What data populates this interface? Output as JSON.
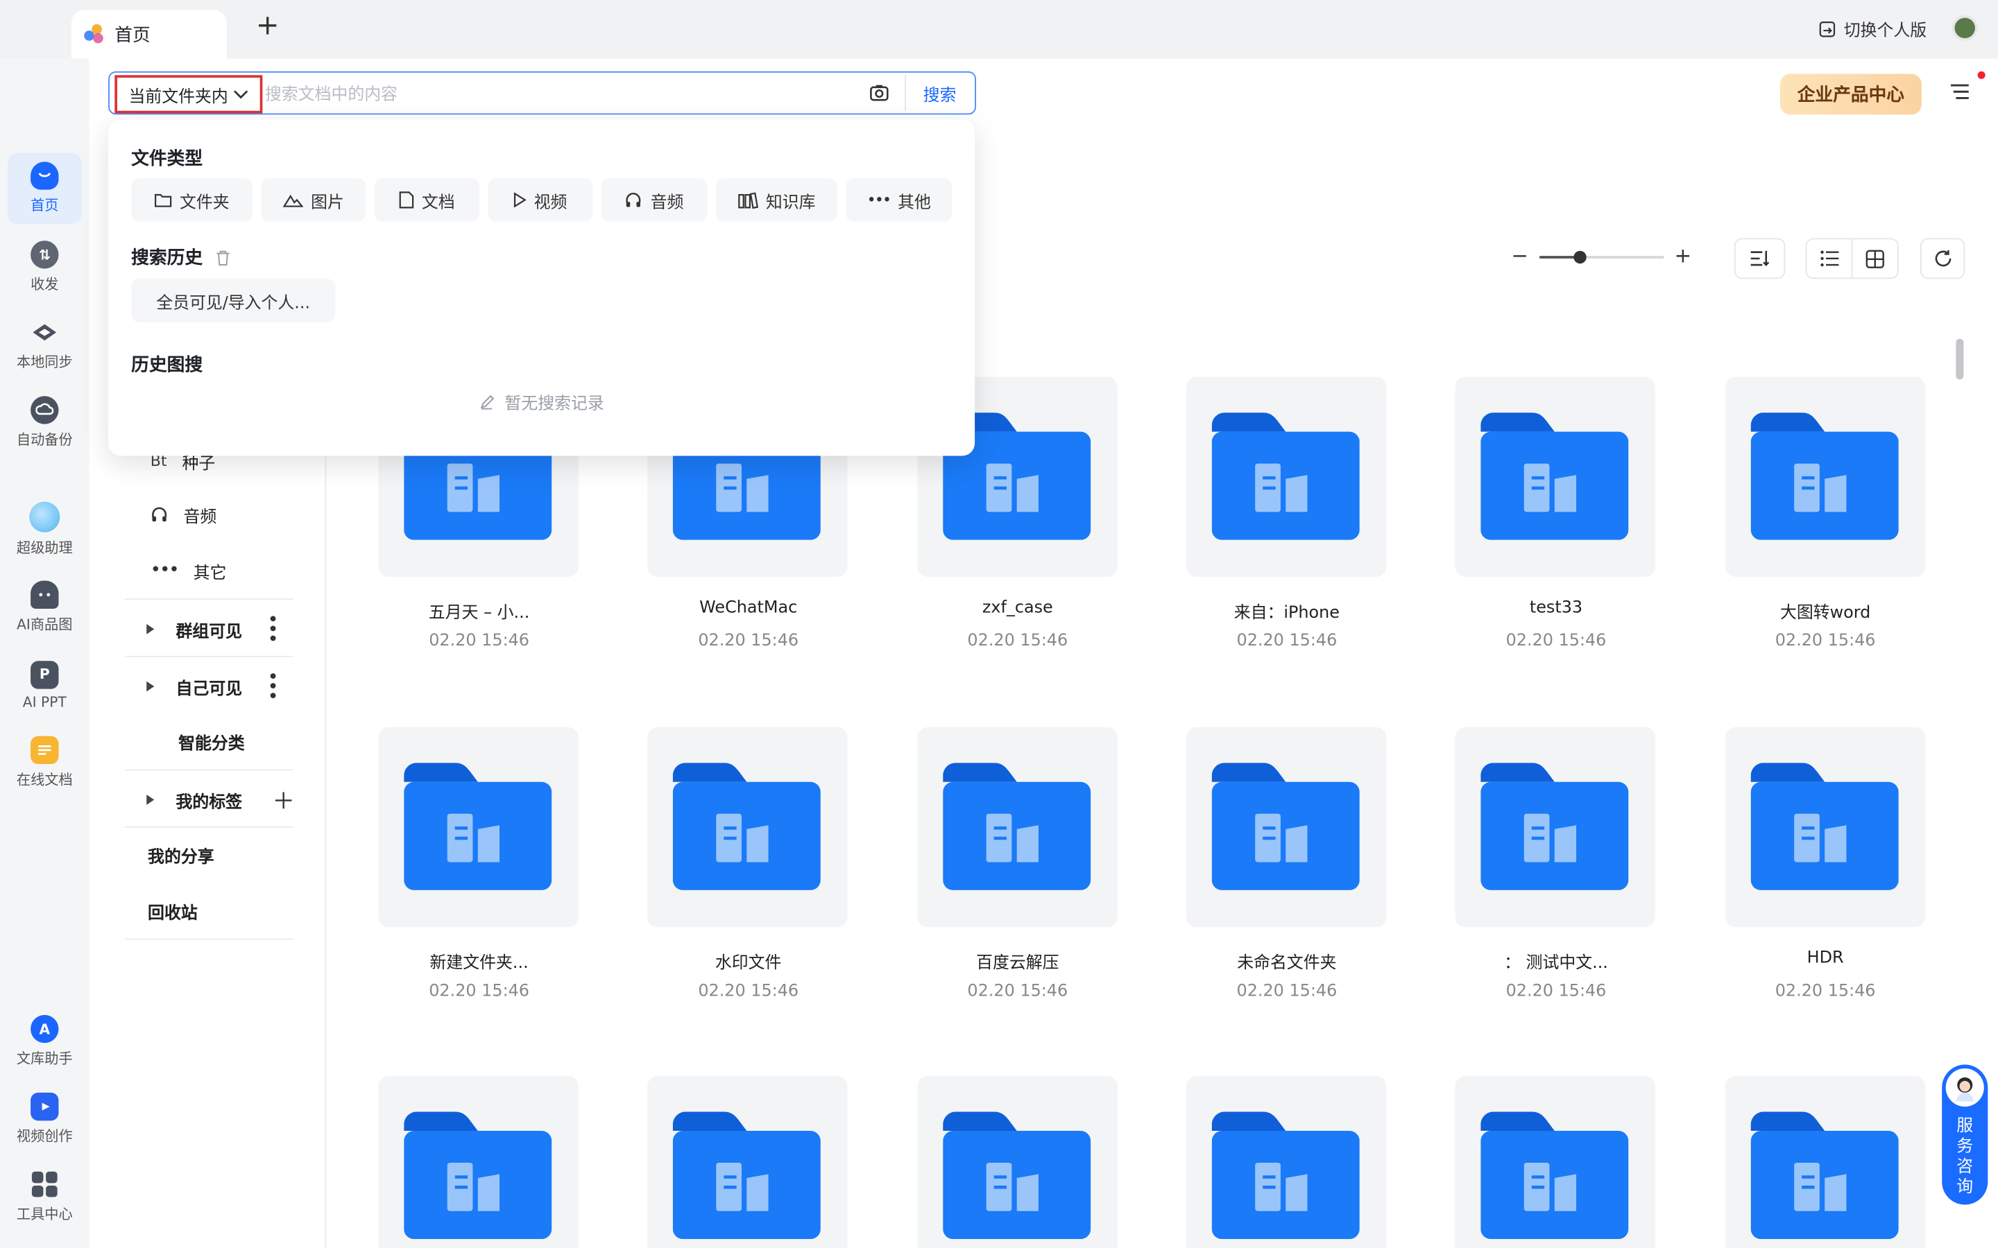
{
  "tab": {
    "title": "首页",
    "add": "+"
  },
  "header": {
    "switch_personal": "切换个人版",
    "enterprise": "企业产品中心"
  },
  "search": {
    "scope": "当前文件夹内",
    "placeholder": "搜索文档中的内容",
    "button": "搜索"
  },
  "rail": [
    {
      "label": "首页",
      "icon": "home-icon"
    },
    {
      "label": "收发",
      "icon": "transfer-icon"
    },
    {
      "label": "本地同步",
      "icon": "sync-icon"
    },
    {
      "label": "自动备份",
      "icon": "backup-icon"
    },
    {
      "label": "超级助理",
      "icon": "assistant-icon"
    },
    {
      "label": "AI商品图",
      "icon": "ai-product-icon"
    },
    {
      "label": "AI PPT",
      "icon": "ai-ppt-icon"
    },
    {
      "label": "在线文档",
      "icon": "online-doc-icon"
    },
    {
      "label": "文库助手",
      "icon": "library-icon"
    },
    {
      "label": "视频创作",
      "icon": "video-create-icon"
    },
    {
      "label": "工具中心",
      "icon": "tools-icon"
    }
  ],
  "dropdown": {
    "file_type_title": "文件类型",
    "file_types": [
      "文件夹",
      "图片",
      "文档",
      "视频",
      "音频",
      "知识库",
      "其他"
    ],
    "history_title": "搜索历史",
    "history_items": [
      "全员可见/导入个人..."
    ],
    "image_history_title": "历史图搜",
    "image_history_empty": "暂无搜索记录"
  },
  "tree": {
    "bt": "Bt",
    "seed": "种子",
    "audio": "音频",
    "other": "其它",
    "group_visible": "群组可见",
    "self_visible": "自己可见",
    "smart_category": "智能分类",
    "my_tags": "我的标签",
    "my_share": "我的分享",
    "recycle": "回收站"
  },
  "zoom": {
    "level": 0.33
  },
  "files": [
    {
      "name": "五月天 – 小...",
      "date": "02.20 15:46"
    },
    {
      "name": "WeChatMac",
      "date": "02.20 15:46"
    },
    {
      "name": "zxf_case",
      "date": "02.20 15:46"
    },
    {
      "name": "来自：iPhone",
      "date": "02.20 15:46"
    },
    {
      "name": "test33",
      "date": "02.20 15:46"
    },
    {
      "name": "大图转word",
      "date": "02.20 15:46"
    },
    {
      "name": "新建文件夹...",
      "date": "02.20 15:46"
    },
    {
      "name": "水印文件",
      "date": "02.20 15:46"
    },
    {
      "name": "百度云解压",
      "date": "02.20 15:46"
    },
    {
      "name": "未命名文件夹",
      "date": "02.20 15:46"
    },
    {
      "name": "：  测试中文...",
      "date": "02.20 15:46"
    },
    {
      "name": "HDR",
      "date": "02.20 15:46"
    },
    {
      "name": "",
      "date": ""
    },
    {
      "name": "",
      "date": ""
    },
    {
      "name": "",
      "date": ""
    },
    {
      "name": "",
      "date": ""
    },
    {
      "name": "",
      "date": ""
    },
    {
      "name": "",
      "date": ""
    }
  ],
  "service": {
    "label": "服务咨询"
  },
  "colors": {
    "accent": "#1a66ff",
    "folder": "#1a73f5",
    "scope_border": "#e03131"
  }
}
